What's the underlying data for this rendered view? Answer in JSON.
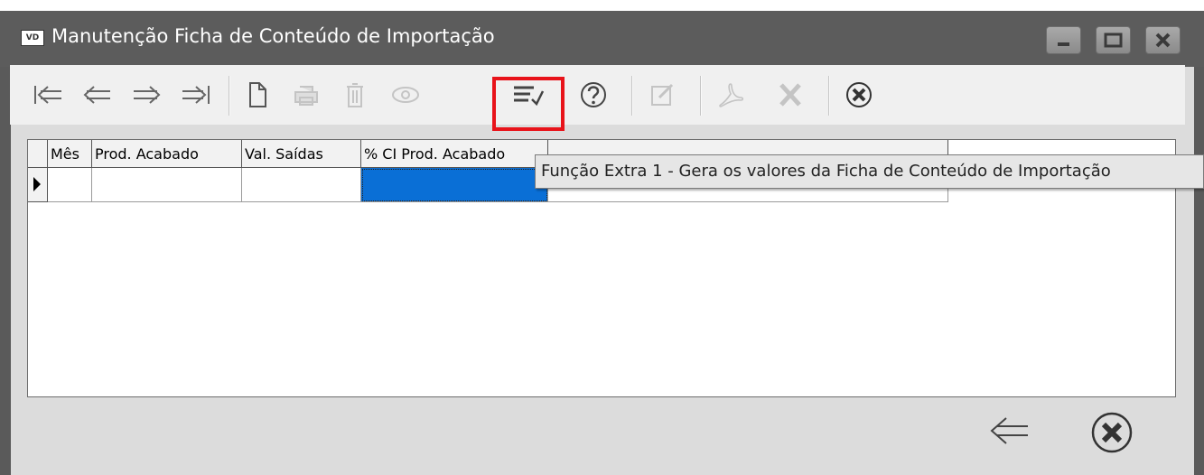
{
  "window": {
    "app_icon_text": "VD",
    "title": "Manutenção Ficha de Conteúdo de Importação"
  },
  "toolbar": {
    "buttons": [
      {
        "name": "first-record",
        "icon": "first-arrow-icon",
        "enabled": true
      },
      {
        "name": "previous-record",
        "icon": "left-arrow-icon",
        "enabled": true
      },
      {
        "name": "next-record",
        "icon": "right-arrow-icon",
        "enabled": true
      },
      {
        "name": "last-record",
        "icon": "last-arrow-icon",
        "enabled": true
      },
      {
        "name": "new",
        "icon": "new-document-icon",
        "enabled": true
      },
      {
        "name": "print",
        "icon": "printer-icon",
        "enabled": false
      },
      {
        "name": "delete",
        "icon": "trash-icon",
        "enabled": false
      },
      {
        "name": "view",
        "icon": "eye-icon",
        "enabled": false
      },
      {
        "name": "extra-function-1",
        "icon": "list-check-icon",
        "enabled": true
      },
      {
        "name": "help",
        "icon": "question-icon",
        "enabled": true
      },
      {
        "name": "edit",
        "icon": "edit-icon",
        "enabled": false
      },
      {
        "name": "pdf",
        "icon": "pdf-icon",
        "enabled": false
      },
      {
        "name": "excel",
        "icon": "excel-x-icon",
        "enabled": false
      },
      {
        "name": "close",
        "icon": "close-circle-icon",
        "enabled": true
      }
    ]
  },
  "grid": {
    "columns": [
      "Mês",
      "Prod. Acabado",
      "Val. Saídas",
      "% CI Prod. Acabado"
    ],
    "rows": [
      [
        "",
        "",
        "",
        ""
      ]
    ]
  },
  "tooltip": {
    "text": "Função Extra 1 - Gera os valores da Ficha de Conteúdo de Importação"
  },
  "colors": {
    "highlight": "#e8131a",
    "selection": "#0a6fd6"
  }
}
